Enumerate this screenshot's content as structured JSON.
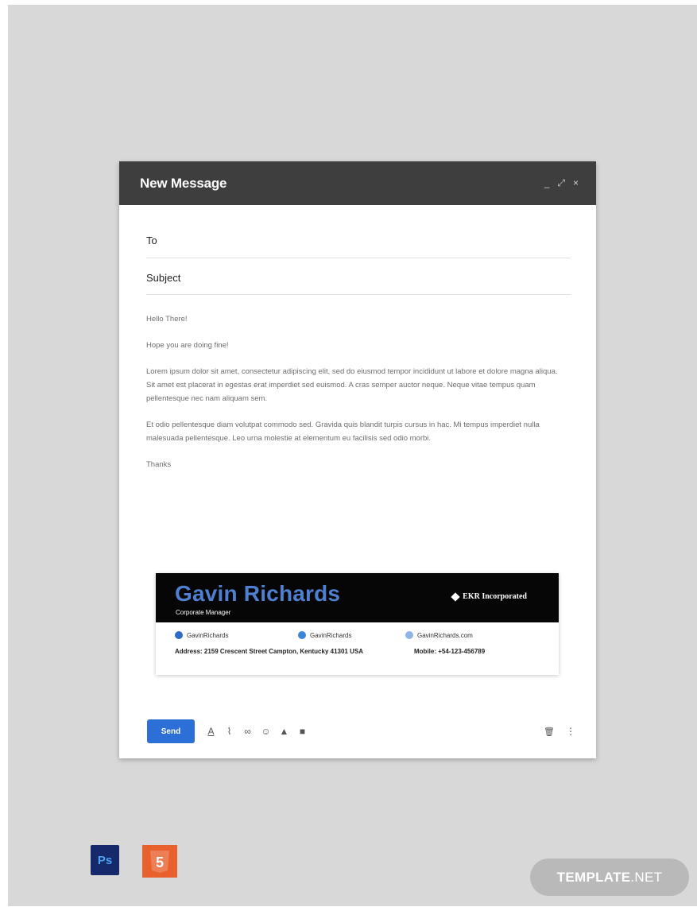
{
  "window": {
    "title": "New Message",
    "controls": {
      "minimize": "_",
      "expand": "⤢",
      "close": "×"
    }
  },
  "fields": {
    "to_label": "To",
    "subject_label": "Subject"
  },
  "message": {
    "greeting": "Hello There!",
    "line1": "Hope you are doing fine!",
    "para1": "Lorem ipsum dolor sit amet, consectetur adipiscing elit, sed do eiusmod tempor incididunt ut labore et dolore magna aliqua. Sit amet est placerat in egestas erat imperdiet sed euismod. A cras semper auctor neque. Neque vitae tempus quam pellentesque nec nam aliquam sem.",
    "para2": " Et odio pellentesque diam volutpat commodo sed. Gravida quis blandit turpis cursus in hac. Mi tempus imperdiet nulla malesuada pellentesque. Leo urna molestie at elementum eu facilisis sed odio morbi.",
    "closing": "Thanks"
  },
  "signature": {
    "name": "Gavin Richards",
    "role": "Corporate Manager",
    "company": "EKR Incorporated",
    "facebook": "GavinRichards",
    "twitter": "GavinRichards",
    "website": "GavinRichards.com",
    "address": "Address: 2159  Crescent Street Campton, Kentucky 41301 USA",
    "mobile": "Mobile: +54-123-456789",
    "colors": {
      "name": "#4f7fd0",
      "header_bg": "#060606"
    }
  },
  "toolbar": {
    "send_label": "Send",
    "icons": [
      "format-text-icon",
      "attach-icon",
      "link-icon",
      "emoji-icon",
      "drive-icon",
      "photo-icon"
    ],
    "icon_glyphs": [
      "A",
      "⌇",
      "∞",
      "☺",
      "▲",
      "■"
    ],
    "trash_glyph": "🗑",
    "more_glyph": "⋮"
  },
  "badges": {
    "ps": "Ps",
    "html5": "5"
  },
  "watermark": {
    "bold": "TEMPLATE",
    "light": ".NET"
  }
}
